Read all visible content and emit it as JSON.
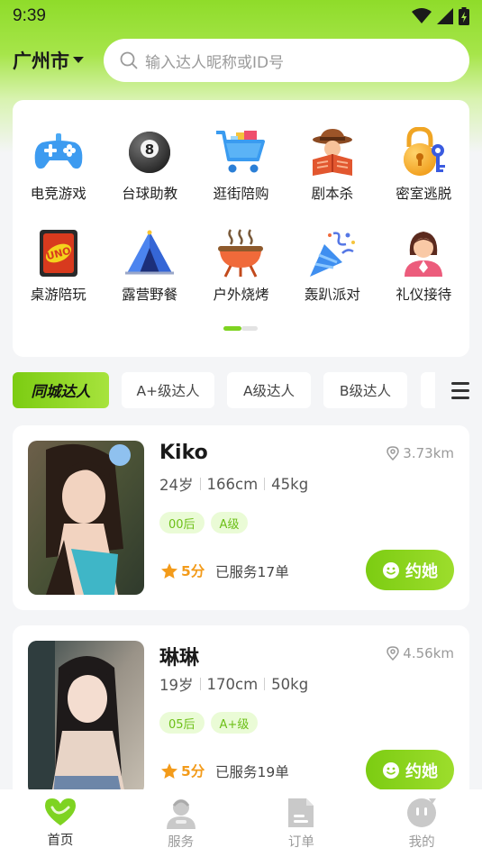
{
  "status_bar": {
    "time": "9:39"
  },
  "header": {
    "city": "广州市",
    "search_placeholder": "输入达人昵称或ID号"
  },
  "categories": [
    {
      "label": "电竞游戏",
      "icon": "gamepad-icon"
    },
    {
      "label": "台球助教",
      "icon": "billiard-ball-icon"
    },
    {
      "label": "逛街陪购",
      "icon": "shopping-cart-icon"
    },
    {
      "label": "剧本杀",
      "icon": "detective-book-icon"
    },
    {
      "label": "密室逃脱",
      "icon": "lock-key-icon"
    },
    {
      "label": "桌游陪玩",
      "icon": "uno-card-icon"
    },
    {
      "label": "露营野餐",
      "icon": "tent-icon"
    },
    {
      "label": "户外烧烤",
      "icon": "grill-icon"
    },
    {
      "label": "轰趴派对",
      "icon": "party-popper-icon"
    },
    {
      "label": "礼仪接待",
      "icon": "receptionist-icon"
    }
  ],
  "filters": {
    "tabs": [
      "同城达人",
      "A+级达人",
      "A级达人",
      "B级达人"
    ],
    "active_index": 0
  },
  "talents": [
    {
      "name": "Kiko",
      "distance": "3.73km",
      "age": "24岁",
      "height": "166cm",
      "weight": "45kg",
      "tags": [
        "00后",
        "A级"
      ],
      "score": "5分",
      "served": "已服务17单",
      "button": "约她"
    },
    {
      "name": "琳琳",
      "distance": "4.56km",
      "age": "19岁",
      "height": "170cm",
      "weight": "50kg",
      "tags": [
        "05后",
        "A+级"
      ],
      "score": "5分",
      "served": "已服务19单",
      "button": "约她"
    }
  ],
  "bottom_nav": {
    "items": [
      {
        "label": "首页",
        "icon": "heart-home-icon"
      },
      {
        "label": "服务",
        "icon": "service-person-icon"
      },
      {
        "label": "订单",
        "icon": "order-document-icon"
      },
      {
        "label": "我的",
        "icon": "profile-icon"
      }
    ],
    "active_index": 0
  },
  "colors": {
    "accent": "#7ed321",
    "tag_bg": "#eafbd6",
    "tag_text": "#6cbf16",
    "star": "#f39b1a"
  }
}
